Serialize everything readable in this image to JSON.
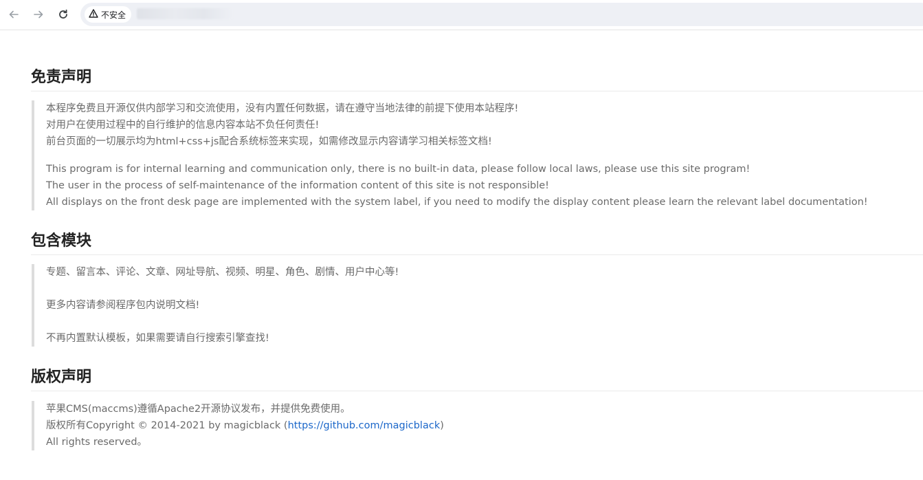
{
  "browser": {
    "security_label": "不安全",
    "icons": [
      "back-arrow-icon",
      "forward-arrow-icon",
      "reload-icon",
      "warning-icon"
    ]
  },
  "disclaimer": {
    "title": "免责声明",
    "zh_lines": [
      "本程序免费且开源仅供内部学习和交流使用，没有内置任何数据，请在遵守当地法律的前提下使用本站程序!",
      "对用户在使用过程中的自行维护的信息内容本站不负任何责任!",
      "前台页面的一切展示均为html+css+js配合系统标签来实现，如需修改显示内容请学习相关标签文档!"
    ],
    "en_lines": [
      "This program is for internal learning and communication only, there is no built-in data, please follow local laws, please use this site program!",
      "The user in the process of self-maintenance of the information content of this site is not responsible!",
      "All displays on the front desk page are implemented with the system label, if you need to modify the display content please learn the relevant label documentation!"
    ]
  },
  "modules": {
    "title": "包含模块",
    "lines": [
      "专题、留言本、评论、文章、网址导航、视频、明星、角色、剧情、用户中心等!",
      "更多内容请参阅程序包内说明文档!",
      "不再内置默认模板，如果需要请自行搜索引擎查找!"
    ]
  },
  "copyright": {
    "title": "版权声明",
    "line1": "苹果CMS(maccms)遵循Apache2开源协议发布，并提供免费使用。",
    "line2_prefix": "版权所有Copyright © 2014-2021 by magicblack (",
    "line2_link": "https://github.com/magicblack",
    "line2_suffix": ")",
    "line3": "All rights reserved。"
  }
}
